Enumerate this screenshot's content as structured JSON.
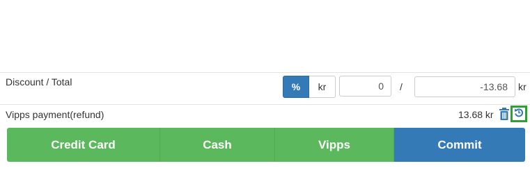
{
  "discount_row": {
    "label": "Discount / Total",
    "percent_label": "%",
    "kr_toggle_label": "kr",
    "discount_value": "0",
    "separator": "/",
    "total_value": "-13.68",
    "total_unit": "kr"
  },
  "payment_row": {
    "label": "Vipps payment(refund)",
    "amount": "13.68 kr",
    "trash_icon": "trash-icon",
    "undo_icon": "undo-icon"
  },
  "payment_buttons": {
    "credit_card": "Credit Card",
    "cash": "Cash",
    "vipps": "Vipps",
    "commit": "Commit"
  },
  "colors": {
    "green": "#5cb85c",
    "blue": "#337ab7",
    "highlight": "#2fa132",
    "trash": "#337ab7"
  }
}
